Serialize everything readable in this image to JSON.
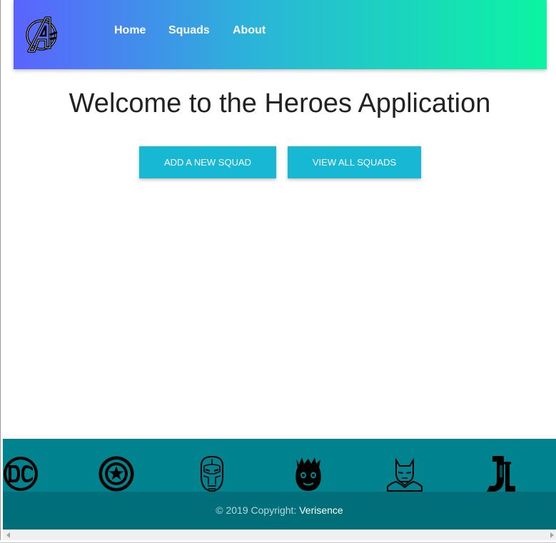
{
  "nav": {
    "brand_icon": "avengers-logo-icon",
    "links": [
      "Home",
      "Squads",
      "About"
    ]
  },
  "main": {
    "title": "Welcome to the Heroes Application",
    "buttons": {
      "add_squad": "ADD A NEW SQUAD",
      "view_squads": "VIEW ALL SQUADS"
    }
  },
  "footer": {
    "icons": [
      "dc-logo-icon",
      "captain-america-shield-icon",
      "iron-man-helmet-icon",
      "groot-icon",
      "batman-icon",
      "justice-league-icon"
    ],
    "copyright_text": "© 2019 Copyright:",
    "copyright_link": "Verisence"
  },
  "colors": {
    "nav_gradient_start": "#5b63ff",
    "nav_gradient_end": "#0bf5a2",
    "button": "#17b8d4",
    "footer_top": "#00838f",
    "footer_bottom": "#006f79"
  }
}
